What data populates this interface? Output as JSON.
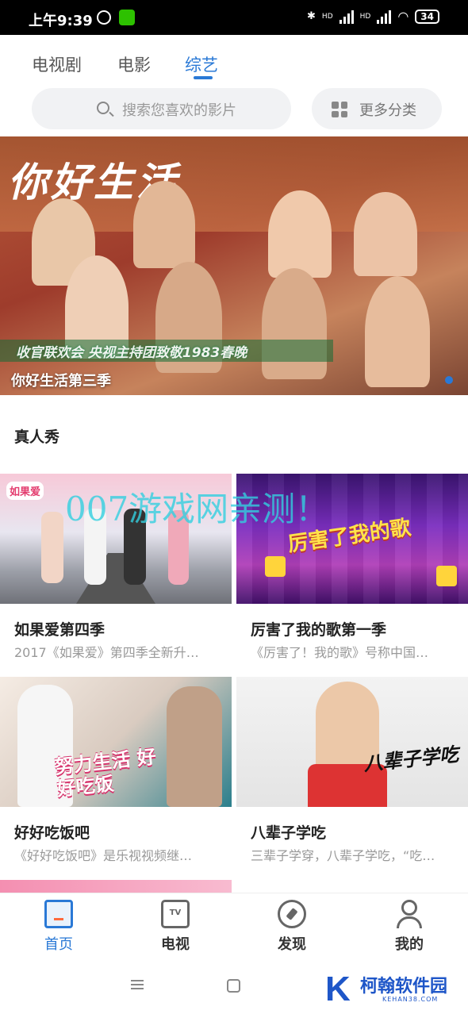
{
  "status_bar": {
    "time": "上午9:39",
    "net_1": "HD",
    "net_2": "HD",
    "battery": "34"
  },
  "tabs": [
    {
      "label": "电视剧"
    },
    {
      "label": "电影"
    },
    {
      "label": "综艺"
    }
  ],
  "active_tab": "综艺",
  "search": {
    "placeholder": "搜索您喜欢的影片"
  },
  "more_categories": {
    "label": "更多分类"
  },
  "banner": {
    "logo": "你好生活",
    "ticker": "收官联欢会 央视主持团致敬1983春晚",
    "caption": "你好生活第三季"
  },
  "section": {
    "title": "真人秀"
  },
  "cards": [
    {
      "title": "如果爱第四季",
      "desc": "2017《如果爱》第四季全新升…",
      "thumb_text": "如果爱"
    },
    {
      "title": "厉害了我的歌第一季",
      "desc": "《厉害了！我的歌》号称中国…",
      "thumb_text": "厉害了我的歌"
    },
    {
      "title": "好好吃饭吧",
      "desc": "《好好吃饭吧》是乐视视频继…",
      "thumb_text": "努力生活 好好吃饭"
    },
    {
      "title": "八辈子学吃",
      "desc": "三辈子学穿，八辈子学吃，“吃…",
      "thumb_text": "八辈子学吃"
    }
  ],
  "watermark": "007游戏网亲测！",
  "bottom_nav": [
    {
      "label": "首页",
      "icon": "home-icon"
    },
    {
      "label": "电视",
      "icon": "tv-icon"
    },
    {
      "label": "发现",
      "icon": "discover-icon"
    },
    {
      "label": "我的",
      "icon": "user-icon"
    }
  ],
  "tv_icon_text": "TV",
  "site_logo": {
    "letter": "K",
    "name": "柯翰软件园",
    "domain": "KEHAN38.COM"
  },
  "colors": {
    "accent": "#2a79d6",
    "watermark": "#33d0e0",
    "logo": "#1e56c8"
  }
}
